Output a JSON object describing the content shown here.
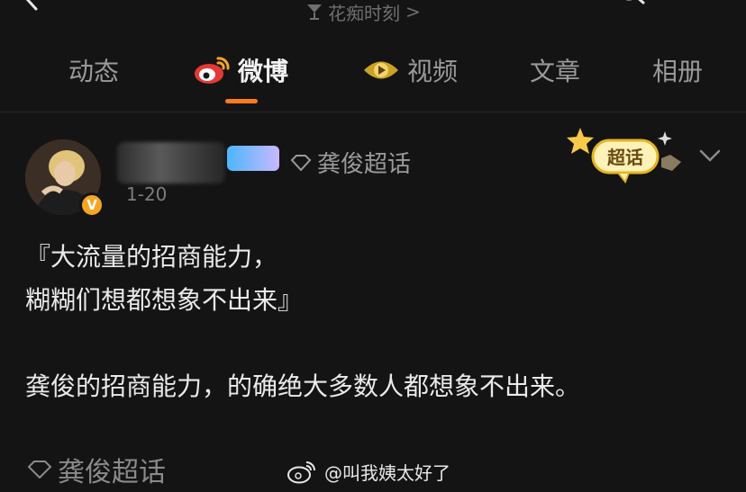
{
  "header": {
    "breadcrumb_label": "花痴时刻",
    "breadcrumb_chevron": ">"
  },
  "tabs": [
    {
      "label": "动态",
      "active": false
    },
    {
      "label": "微博",
      "active": true
    },
    {
      "label": "视频",
      "active": false
    },
    {
      "label": "文章",
      "active": false
    },
    {
      "label": "相册",
      "active": false
    }
  ],
  "post": {
    "topic_label": "龚俊超话",
    "time": "1-20",
    "verified_badge": "V",
    "chaohua_badge_text": "超话",
    "lines": [
      "『大流量的招商能力，",
      "糊糊们想都想象不出来』",
      "龚俊的招商能力，的确绝大多数人都想象不出来。"
    ],
    "footer_topic": "龚俊超话"
  },
  "watermark": {
    "text": "@叫我姨太好了"
  },
  "colors": {
    "background": "#141414",
    "accent": "#ff7a1a",
    "verified": "#f5a623"
  }
}
